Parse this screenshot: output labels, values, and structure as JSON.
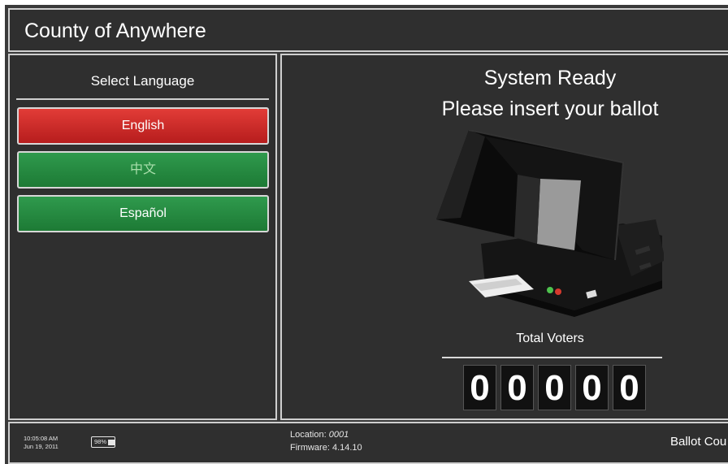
{
  "header": {
    "title": "County of Anywhere"
  },
  "language_panel": {
    "title": "Select Language",
    "options": [
      {
        "label": "English",
        "selected": true,
        "color": "#d12c2a"
      },
      {
        "label": "中文",
        "selected": false,
        "color": "#278a41"
      },
      {
        "label": "Español",
        "selected": false,
        "color": "#278a41"
      }
    ]
  },
  "status": {
    "line1": "System Ready",
    "line2": "Please insert your ballot",
    "illustration_icon": "ballot-scanner-machine"
  },
  "voters": {
    "label": "Total Voters",
    "digits": [
      "0",
      "0",
      "0",
      "0",
      "0"
    ]
  },
  "footer": {
    "time": "10:05:08 AM",
    "date": "Jun 19, 2011",
    "battery": {
      "label": "98%",
      "level": 0.98,
      "icon": "battery-plugged-icon"
    },
    "location_label": "Location:",
    "location_value": "0001",
    "firmware_label": "Firmware:",
    "firmware_value": "4.14.10",
    "ballot_count_label": "Ballot Cou"
  }
}
